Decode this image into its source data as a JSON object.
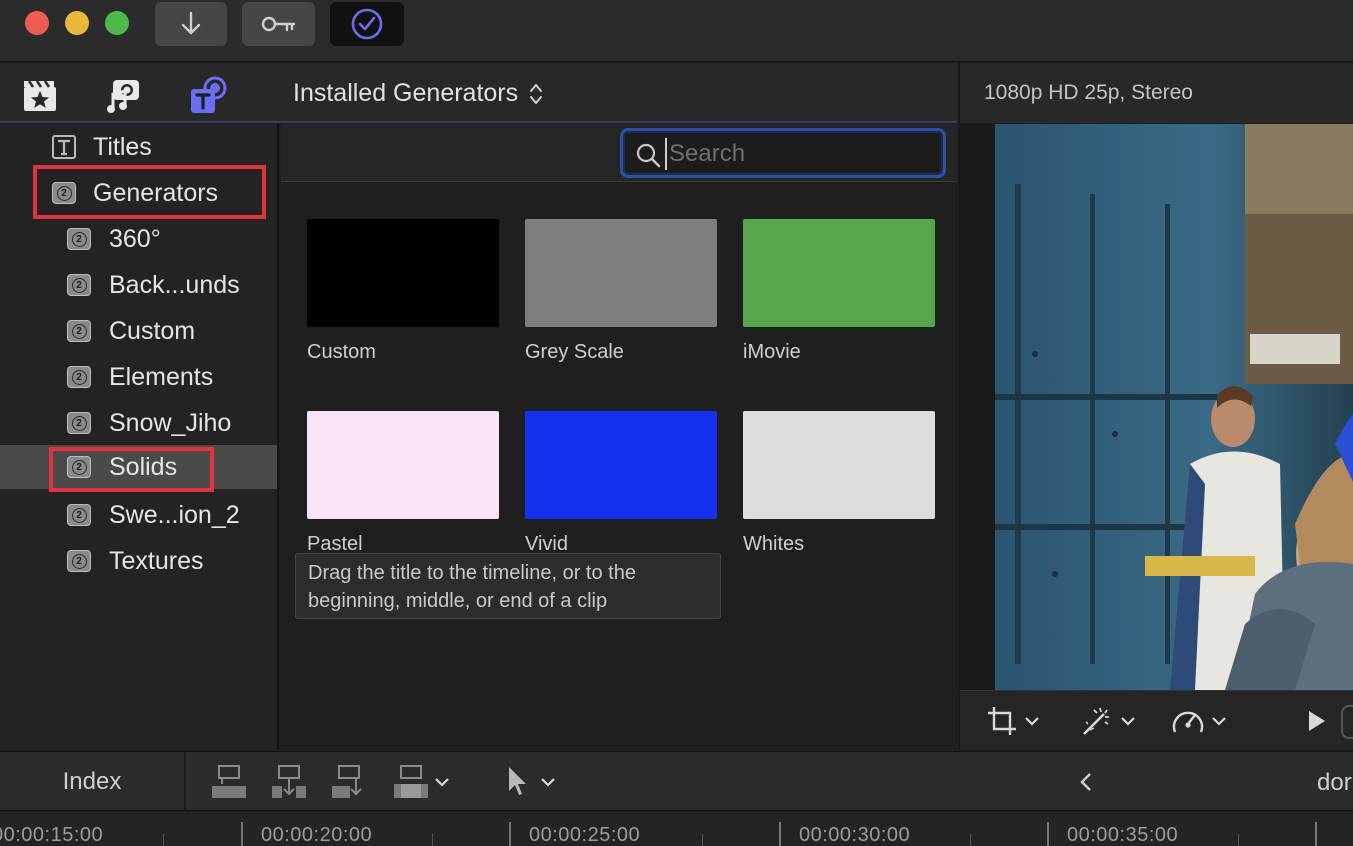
{
  "titlebar": {
    "traffic_colors": [
      "#ec5c54",
      "#e6b93a",
      "#4fb84a"
    ],
    "buttons": [
      {
        "name": "import-button",
        "icon": "down-arrow-icon"
      },
      {
        "name": "keywords-button",
        "icon": "key-icon"
      },
      {
        "name": "background-tasks-button",
        "icon": "check-circle-icon"
      }
    ]
  },
  "browser": {
    "tabs": [
      {
        "name": "libraries-tab",
        "icon": "clapper-star-icon"
      },
      {
        "name": "photos-audio-tab",
        "icon": "camera-music-icon"
      },
      {
        "name": "titles-generators-tab",
        "icon": "titles-generators-icon",
        "active": true
      }
    ],
    "generator_menu_label": "Installed Generators",
    "search_placeholder": "Search"
  },
  "sidebar": {
    "items": [
      {
        "label": "Titles",
        "level": 0,
        "expanded": false
      },
      {
        "label": "Generators",
        "level": 0,
        "expanded": true
      },
      {
        "label": "360°",
        "level": 1
      },
      {
        "label": "Back...unds",
        "level": 1
      },
      {
        "label": "Custom",
        "level": 1
      },
      {
        "label": "Elements",
        "level": 1
      },
      {
        "label": "Snow_Jiho",
        "level": 1
      },
      {
        "label": "Solids",
        "level": 1,
        "selected": true
      },
      {
        "label": "Swe...ion_2",
        "level": 1
      },
      {
        "label": "Textures",
        "level": 1
      }
    ],
    "highlight_color": "#e2323d"
  },
  "generators": [
    {
      "label": "Custom",
      "color": "#000000"
    },
    {
      "label": "Grey Scale",
      "color": "#7d7d7d"
    },
    {
      "label": "iMovie",
      "color": "#56a64d"
    },
    {
      "label": "Pastel",
      "color": "#f9e4f7"
    },
    {
      "label": "Vivid",
      "color": "#1530f0"
    },
    {
      "label": "Whites",
      "color": "#dcdcdc"
    }
  ],
  "tooltip": {
    "line1": "Drag the title to the timeline, or to the",
    "line2": "beginning, middle, or end of a clip"
  },
  "viewer": {
    "format": "1080p HD 25p, Stereo",
    "controls": [
      {
        "name": "crop-menu",
        "icon": "crop-icon"
      },
      {
        "name": "enhance-menu",
        "icon": "magic-wand-icon"
      },
      {
        "name": "retime-menu",
        "icon": "speedometer-icon"
      },
      {
        "name": "play-button",
        "icon": "play-icon"
      }
    ]
  },
  "toolbar": {
    "index_label": "Index",
    "right_text": "dor"
  },
  "timeline": {
    "timecodes": [
      "00:00:15:00",
      "00:00:20:00",
      "00:00:25:00",
      "00:00:30:00",
      "00:00:35:00"
    ]
  }
}
